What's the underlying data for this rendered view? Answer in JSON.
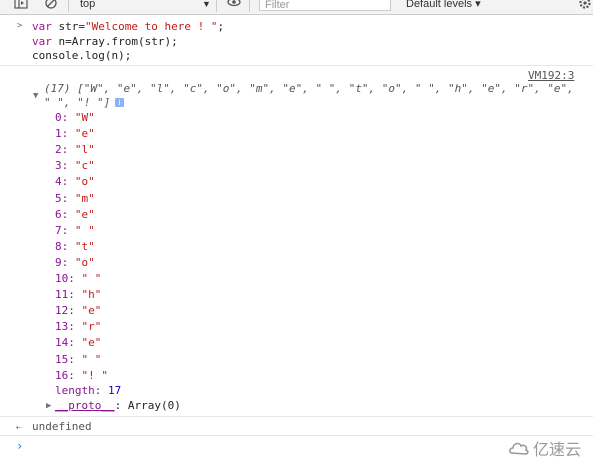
{
  "toolbar": {
    "context": "top",
    "filter_placeholder": "Filter",
    "levels": "Default levels ▾"
  },
  "command": {
    "line1_kw": "var",
    "line1_rest": " str=",
    "line1_str": "\"Welcome to here ! \"",
    "line1_end": ";",
    "line2_kw": "var",
    "line2_rest": " n=Array.from(str);",
    "line3": "console.log(n);"
  },
  "source_link": "VM192:3",
  "array_header_line1": "(17) [\"W\", \"e\", \"l\", \"c\", \"o\", \"m\", \"e\", \" \", \"t\", \"o\", \" \", \"h\", \"e\", \"r\", \"e\",",
  "array_header_line2": "\" \", \"! \"]",
  "info_badge": "i",
  "items": [
    {
      "k": "0:",
      "v": "\"W\""
    },
    {
      "k": "1:",
      "v": "\"e\""
    },
    {
      "k": "2:",
      "v": "\"l\""
    },
    {
      "k": "3:",
      "v": "\"c\""
    },
    {
      "k": "4:",
      "v": "\"o\""
    },
    {
      "k": "5:",
      "v": "\"m\""
    },
    {
      "k": "6:",
      "v": "\"e\""
    },
    {
      "k": "7:",
      "v": "\" \""
    },
    {
      "k": "8:",
      "v": "\"t\""
    },
    {
      "k": "9:",
      "v": "\"o\""
    },
    {
      "k": "10:",
      "v": "\" \""
    },
    {
      "k": "11:",
      "v": "\"h\""
    },
    {
      "k": "12:",
      "v": "\"e\""
    },
    {
      "k": "13:",
      "v": "\"r\""
    },
    {
      "k": "14:",
      "v": "\"e\""
    },
    {
      "k": "15:",
      "v": "\" \""
    },
    {
      "k": "16:",
      "v": "\"! \""
    }
  ],
  "length_key": "length:",
  "length_val": "17",
  "proto_key": "__proto__",
  "proto_val": ": Array(0)",
  "result": "undefined",
  "watermark": "亿速云"
}
